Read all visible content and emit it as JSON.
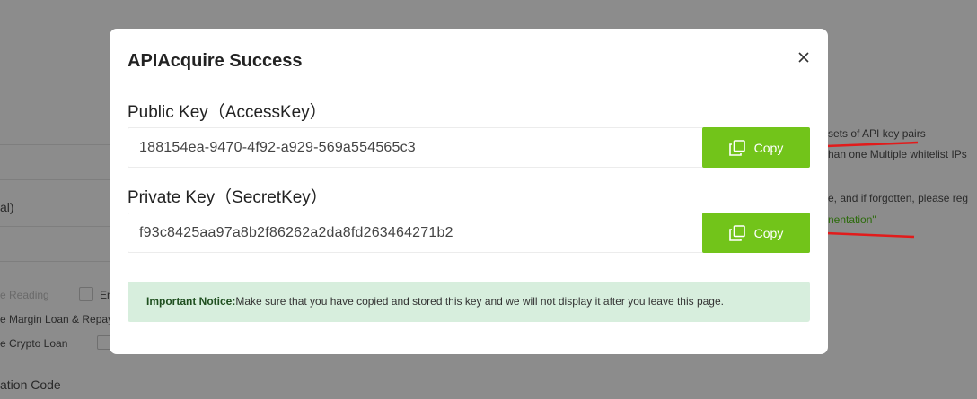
{
  "background": {
    "right_texts": [
      "sets of API key pairs",
      "han one Multiple whitelist IPs",
      "e, and if forgotten, please reg",
      "nentation\""
    ],
    "left_texts": [
      "al)",
      "e Reading",
      "En",
      "e Margin Loan & Repay",
      "e Crypto Loan",
      "ation Code"
    ]
  },
  "modal": {
    "title": "APIAcquire Success",
    "close_icon": "close-icon",
    "public_key": {
      "label": "Public Key（AccessKey）",
      "value": "188154ea-9470-4f92-a929-569a554565c3",
      "copy_label": "Copy"
    },
    "private_key": {
      "label": "Private Key（SecretKey）",
      "value": "f93c8425aa97a8b2f86262a2da8fd263464271b2",
      "copy_label": "Copy"
    },
    "notice": {
      "title": "Important Notice:",
      "text": "Make sure that you have copied and stored this key and we will not display it after you leave this page."
    }
  },
  "colors": {
    "accent": "#72c41a",
    "notice_bg": "#d7eedd",
    "annotation": "#e21b1b",
    "overlay": "#8c8c8c"
  }
}
